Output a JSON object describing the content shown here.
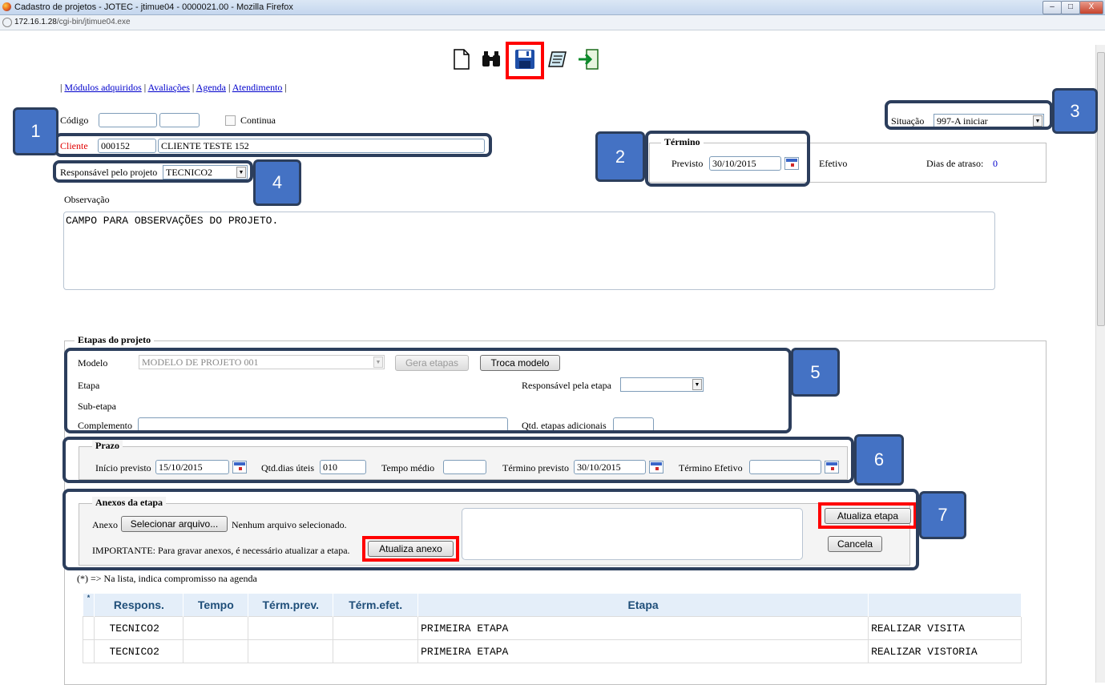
{
  "window": {
    "title": "Cadastro de projetos - JOTEC - jtimue04 - 0000021.00 - Mozilla Firefox",
    "url_host": "172.16.1.28",
    "url_path": "/cgi-bin/jtimue04.exe",
    "controls": {
      "minimize": "–",
      "maximize": "□",
      "close": "X"
    }
  },
  "toolbar": {
    "icons": [
      "new-document-icon",
      "search-binoculars-icon",
      "save-floppy-icon",
      "notes-icon",
      "exit-icon"
    ]
  },
  "nav": {
    "links": [
      "Módulos adquiridos",
      "Avaliações",
      "Agenda",
      "Atendimento"
    ],
    "separator": "|"
  },
  "form": {
    "codigo_label": "Código",
    "codigo_value1": "",
    "codigo_value2": "",
    "continua_label": "Continua",
    "cliente_label": "Cliente",
    "cliente_code": "000152",
    "cliente_name": "CLIENTE TESTE 152",
    "situacao_label": "Situação",
    "situacao_value": "997-A iniciar",
    "responsavel_label": "Responsável pelo projeto",
    "responsavel_value": "TECNICO2",
    "termino_legend": "Término",
    "previsto_label": "Previsto",
    "previsto_value": "30/10/2015",
    "efetivo_label": "Efetivo",
    "dias_atraso_label": "Dias de atraso:",
    "dias_atraso_value": "0",
    "observacao_label": "Observação",
    "observacao_value": "CAMPO PARA OBSERVAÇÕES DO PROJETO."
  },
  "etapas": {
    "legend": "Etapas do projeto",
    "modelo_label": "Modelo",
    "modelo_value": "MODELO DE PROJETO 001",
    "gera_etapas": "Gera etapas",
    "troca_modelo": "Troca modelo",
    "etapa_label": "Etapa",
    "responsavel_etapa_label": "Responsável pela etapa",
    "responsavel_etapa_value": "",
    "subetapa_label": "Sub-etapa",
    "complemento_label": "Complemento",
    "complemento_value": "",
    "qtd_adicionais_label": "Qtd. etapas adicionais",
    "qtd_adicionais_value": ""
  },
  "prazo": {
    "legend": "Prazo",
    "inicio_label": "Início previsto",
    "inicio_value": "15/10/2015",
    "qtd_dias_label": "Qtd.dias úteis",
    "qtd_dias_value": "010",
    "tempo_medio_label": "Tempo médio",
    "tempo_medio_value": "",
    "termino_prev_label": "Término previsto",
    "termino_prev_value": "30/10/2015",
    "termino_efet_label": "Término Efetivo",
    "termino_efet_value": ""
  },
  "anexos": {
    "legend": "Anexos da etapa",
    "anexo_label": "Anexo",
    "select_file": "Selecionar arquivo...",
    "no_file": "Nenhum arquivo selecionado.",
    "importante": "IMPORTANTE: Para gravar anexos, é necessário atualizar a etapa.",
    "atualiza_anexo": "Atualiza anexo",
    "atualiza_etapa": "Atualiza etapa",
    "cancela": "Cancela"
  },
  "agenda_note": "(*) => Na lista, indica compromisso na agenda",
  "table": {
    "headers": [
      "*",
      "Respons.",
      "Tempo",
      "Térm.prev.",
      "Térm.efet.",
      "Etapa",
      ""
    ],
    "rows": [
      [
        "",
        "TECNICO2",
        "",
        "",
        "",
        "PRIMEIRA ETAPA",
        "REALIZAR VISITA"
      ],
      [
        "",
        "TECNICO2",
        "",
        "",
        "",
        "PRIMEIRA ETAPA",
        "REALIZAR VISTORIA"
      ]
    ]
  },
  "callouts": [
    "1",
    "2",
    "3",
    "4",
    "5",
    "6",
    "7"
  ],
  "colors": {
    "callout_fill": "#4472c4",
    "callout_border": "#2c3e5c",
    "highlight_red": "#ff0000",
    "link": "#0000cc",
    "table_header": "#1f4e79"
  }
}
